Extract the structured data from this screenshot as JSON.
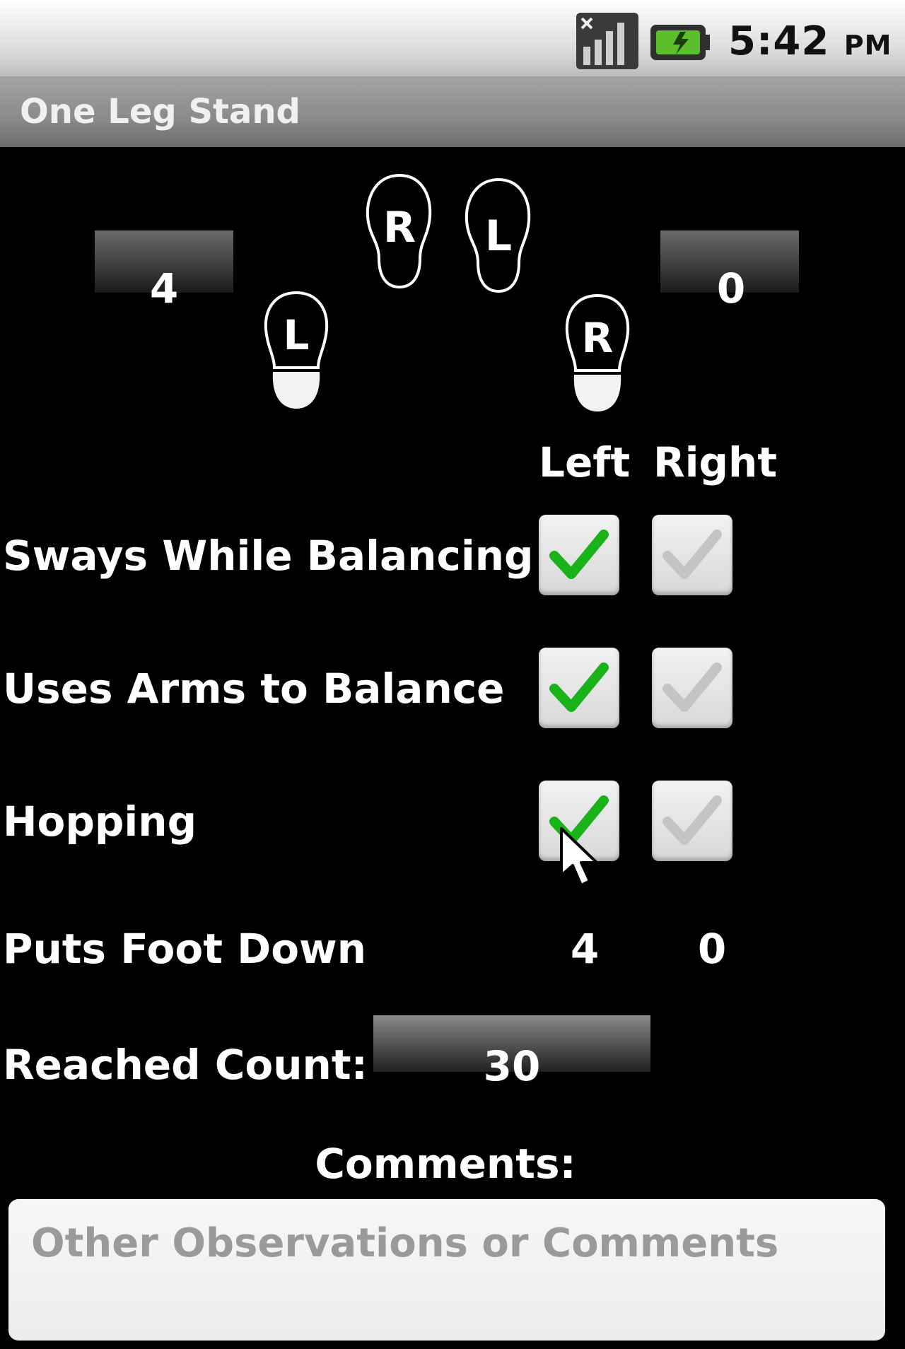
{
  "status_bar": {
    "time": "5:42",
    "ampm": "PM",
    "icons": [
      "signal-icon",
      "battery-icon"
    ]
  },
  "app": {
    "title": "One Leg Stand"
  },
  "counters": {
    "left": "4",
    "right": "0"
  },
  "feet_icons": [
    {
      "name": "left-foot-icon",
      "letter": "L"
    },
    {
      "name": "right-foot-icon",
      "letter": "R"
    },
    {
      "name": "left-foot-icon",
      "letter": "L"
    },
    {
      "name": "right-foot-icon",
      "letter": "R"
    }
  ],
  "columns": {
    "left": "Left",
    "right": "Right"
  },
  "rows": [
    {
      "label": "Sways While Balancing",
      "left_checked": true,
      "right_checked": false
    },
    {
      "label": "Uses Arms to Balance",
      "left_checked": true,
      "right_checked": false
    },
    {
      "label": "Hopping",
      "left_checked": true,
      "right_checked": false
    }
  ],
  "puts_foot_down": {
    "label": "Puts Foot Down",
    "left": "4",
    "right": "0"
  },
  "reached_count": {
    "label": "Reached Count:",
    "value": "30"
  },
  "comments": {
    "label": "Comments:",
    "placeholder": "Other Observations or Comments",
    "value": ""
  },
  "colors": {
    "check_green": "#19b219",
    "check_gray": "#c4c4c4",
    "background": "#000000"
  }
}
